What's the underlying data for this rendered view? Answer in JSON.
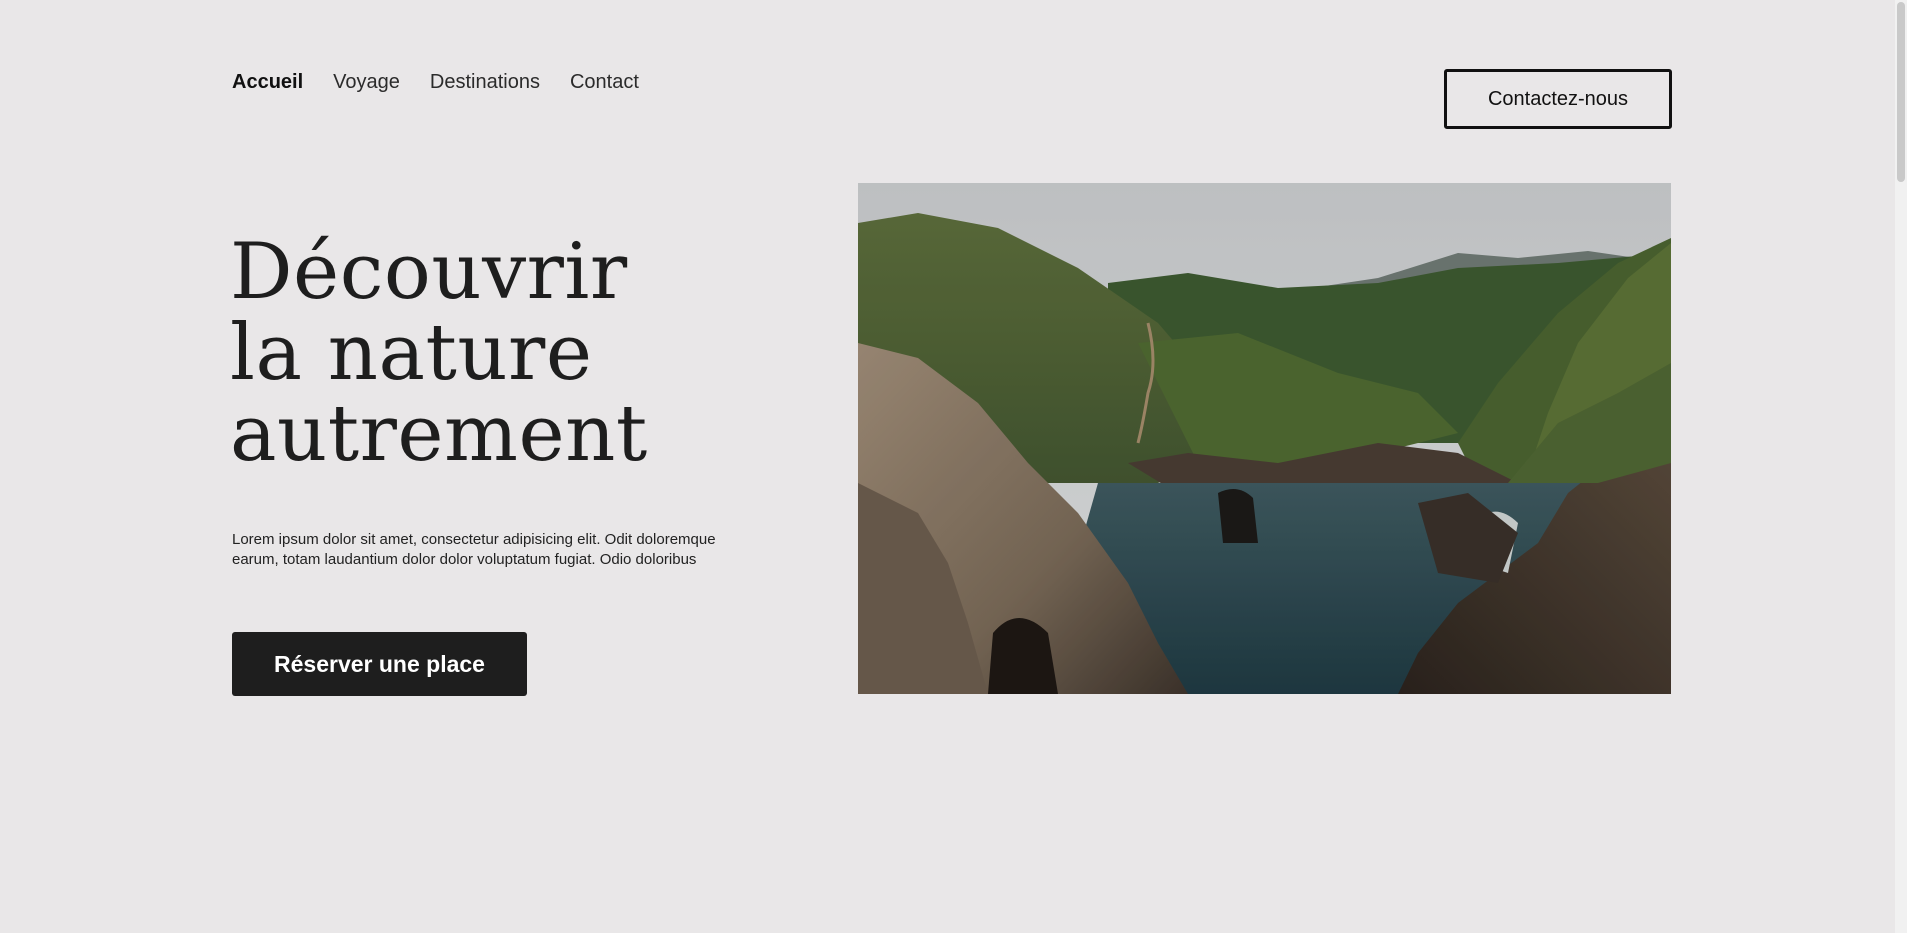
{
  "nav": {
    "items": [
      {
        "label": "Accueil",
        "active": true
      },
      {
        "label": "Voyage",
        "active": false
      },
      {
        "label": "Destinations",
        "active": false
      },
      {
        "label": "Contact",
        "active": false
      }
    ],
    "cta_label": "Contactez-nous"
  },
  "hero": {
    "title_lines": [
      "Découvrir",
      "la nature",
      "autrement"
    ],
    "description_line1": "Lorem ipsum dolor sit amet, consectetur adipisicing elit. Odit doloremque",
    "description_line2": "earum, totam laudantium dolor dolor voluptatum fugiat. Odio doloribus",
    "button_label": "Réserver une place"
  },
  "colors": {
    "background": "#e9e7e8",
    "text": "#1e1e1e",
    "button": "#1e1e1e",
    "button_text": "#ffffff"
  },
  "icons": {
    "hero_image": "coastal-cliffs-landscape"
  }
}
